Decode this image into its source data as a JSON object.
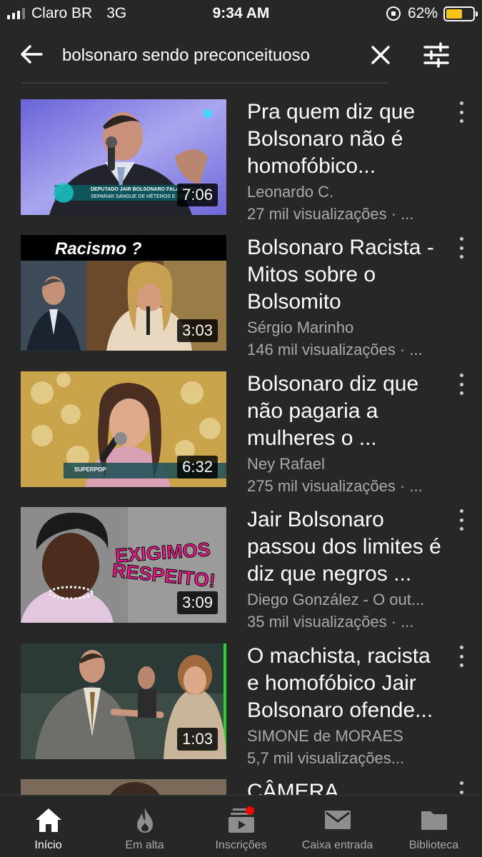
{
  "status": {
    "carrier": "Claro BR",
    "network": "3G",
    "time": "9:34 AM",
    "battery_pct": "62%",
    "battery_level": 0.62
  },
  "search": {
    "query": "bolsonaro sendo preconceituoso"
  },
  "videos": [
    {
      "title": "Pra quem diz que Bolsonaro não é homofóbico...",
      "channel": "Leonardo C.",
      "views": "27 mil visualizações · ...",
      "duration": "7:06",
      "caption": "DEPUTADO JAIR BOLSONARO FALA DA POLÊ SEPARAR SANGUE DE HÉTEROS E HOMOSS"
    },
    {
      "title": "Bolsonaro Racista - Mitos sobre o Bolsomito",
      "channel": "Sérgio Marinho",
      "views": "146 mil visualizações · ...",
      "duration": "3:03",
      "overlay_text": "Racismo ?"
    },
    {
      "title": "Bolsonaro diz que não pagaria a mulheres o ...",
      "channel": "Ney Rafael",
      "views": "275 mil visualizações · ...",
      "duration": "6:32",
      "caption": "SUPERPOP"
    },
    {
      "title": "Jair Bolsonaro passou dos limites é diz que negros ...",
      "channel": "Diego González - O out...",
      "views": "35 mil visualizações · ...",
      "duration": "3:09",
      "overlay_text": "EXIGIMOS RESPEITO!"
    },
    {
      "title": "O machista, racista e homofóbico Jair Bolsonaro ofende...",
      "channel": "SIMONE de MORAES",
      "views": "5,7 mil visualizações...",
      "duration": "1:03"
    },
    {
      "title": "CÂMERA",
      "channel": "",
      "views": "",
      "duration": ""
    }
  ],
  "nav": [
    {
      "label": "Início",
      "icon": "home-icon"
    },
    {
      "label": "Em alta",
      "icon": "flame-icon"
    },
    {
      "label": "Inscrições",
      "icon": "subscriptions-icon"
    },
    {
      "label": "Caixa entrada",
      "icon": "mail-icon"
    },
    {
      "label": "Biblioteca",
      "icon": "folder-icon"
    }
  ],
  "colors": {
    "background": "#272727",
    "accent_red": "#ff0000",
    "battery": "#f5c518",
    "secondary_text": "#aaaaaa"
  }
}
